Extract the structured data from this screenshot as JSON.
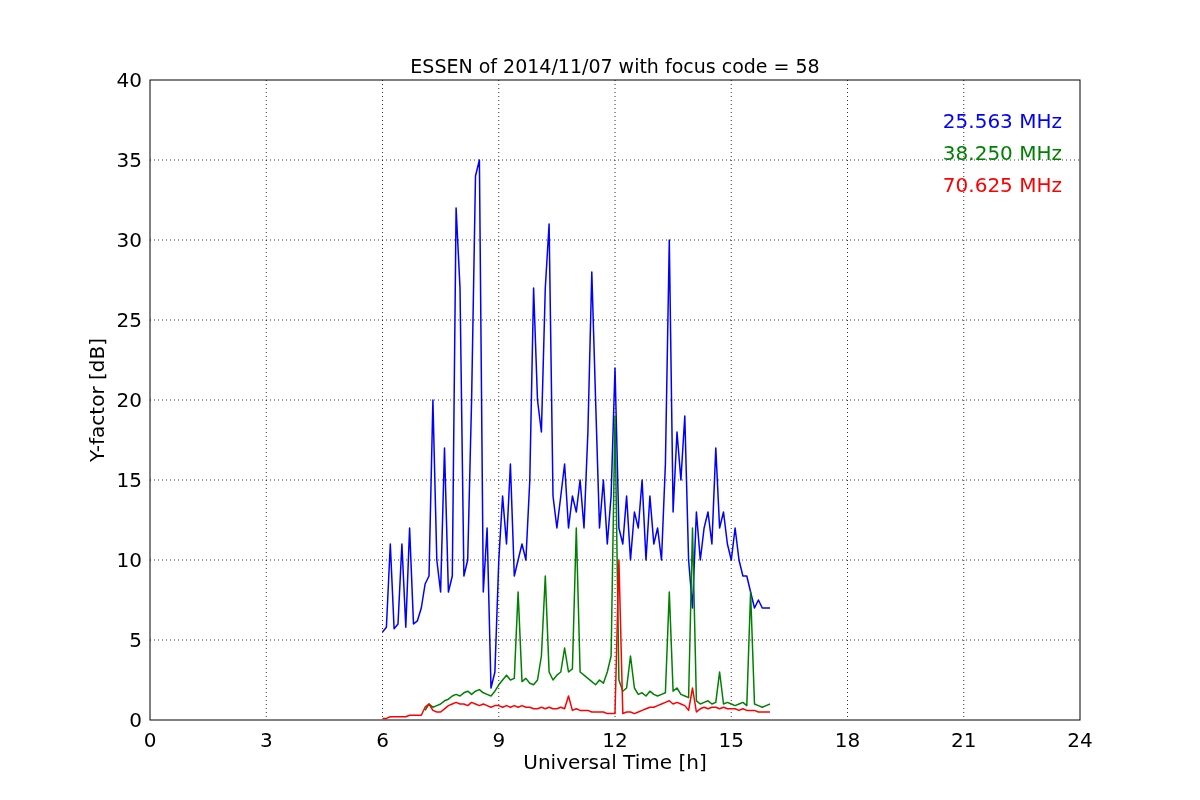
{
  "figure": {
    "chart_data": {
      "type": "line",
      "title": "ESSEN of 2014/11/07 with focus code = 58",
      "xlabel": "Universal Time [h]",
      "ylabel": "Y-factor [dB]",
      "grid": true,
      "xlim": [
        0,
        24
      ],
      "ylim": [
        0,
        40
      ],
      "xticks": [
        0,
        3,
        6,
        9,
        12,
        15,
        18,
        21,
        24
      ],
      "yticks": [
        0,
        5,
        10,
        15,
        20,
        25,
        30,
        35,
        40
      ],
      "x": [
        6.0,
        6.1,
        6.2,
        6.3,
        6.4,
        6.5,
        6.6,
        6.7,
        6.8,
        6.9,
        7.0,
        7.1,
        7.2,
        7.3,
        7.4,
        7.5,
        7.6,
        7.7,
        7.8,
        7.9,
        8.0,
        8.1,
        8.2,
        8.3,
        8.4,
        8.5,
        8.6,
        8.7,
        8.8,
        8.9,
        9.0,
        9.1,
        9.2,
        9.3,
        9.4,
        9.5,
        9.6,
        9.7,
        9.8,
        9.9,
        10.0,
        10.1,
        10.2,
        10.3,
        10.4,
        10.5,
        10.6,
        10.7,
        10.8,
        10.9,
        11.0,
        11.1,
        11.2,
        11.3,
        11.4,
        11.5,
        11.6,
        11.7,
        11.8,
        11.9,
        12.0,
        12.1,
        12.2,
        12.3,
        12.4,
        12.5,
        12.6,
        12.7,
        12.8,
        12.9,
        13.0,
        13.1,
        13.2,
        13.3,
        13.4,
        13.5,
        13.6,
        13.7,
        13.8,
        13.9,
        14.0,
        14.1,
        14.2,
        14.3,
        14.4,
        14.5,
        14.6,
        14.7,
        14.8,
        14.9,
        15.0,
        15.1,
        15.2,
        15.3,
        15.4,
        15.5,
        15.6,
        15.7,
        15.8,
        15.9,
        16.0
      ],
      "series": [
        {
          "name": "25.563 MHz",
          "color": "#0000ff",
          "values": [
            5.5,
            5.8,
            11,
            5.7,
            6,
            11,
            5.8,
            12,
            6,
            6.2,
            7,
            8.5,
            9,
            20,
            10,
            8,
            17,
            8,
            9,
            32,
            27,
            9,
            10,
            20,
            34,
            35,
            8,
            12,
            2,
            3,
            10,
            14,
            11,
            16,
            9,
            10,
            11,
            10,
            15,
            27,
            20,
            18,
            27,
            31,
            14,
            12,
            14,
            16,
            12,
            14,
            13,
            15,
            12,
            18,
            28,
            20,
            12,
            15,
            11,
            14,
            22,
            12,
            11,
            14,
            10,
            13,
            12,
            15,
            10,
            14,
            11,
            12,
            10,
            16,
            30,
            13,
            18,
            15,
            19,
            10,
            7,
            13,
            10,
            12,
            13,
            11,
            17,
            12,
            13,
            11,
            10,
            12,
            10,
            9,
            9,
            8,
            7,
            7.5,
            7,
            7,
            7
          ]
        },
        {
          "name": "38.250 MHz",
          "color": "#008000",
          "values": [
            null,
            null,
            null,
            null,
            null,
            null,
            null,
            null,
            null,
            null,
            null,
            0.6,
            1,
            0.8,
            0.9,
            1,
            1.2,
            1.3,
            1.5,
            1.6,
            1.5,
            1.7,
            1.8,
            1.6,
            1.8,
            1.9,
            1.7,
            1.6,
            1.5,
            1.8,
            2.2,
            2.5,
            2.8,
            2.5,
            2.6,
            8,
            2.4,
            2.6,
            2.3,
            2.2,
            2.5,
            4,
            9,
            3,
            2.5,
            2.8,
            3,
            4.5,
            3,
            3.2,
            12,
            3,
            2.8,
            2.6,
            2.4,
            2.2,
            2.5,
            2.3,
            3,
            4,
            19,
            2.5,
            1.8,
            2,
            4,
            2,
            1.6,
            1.7,
            1.5,
            1.8,
            1.6,
            1.5,
            1.6,
            1.7,
            8,
            1.8,
            2,
            1.6,
            1.5,
            1.4,
            12,
            1.2,
            1.0,
            1.1,
            1.2,
            1.0,
            1.1,
            3,
            1.0,
            1.1,
            1.0,
            0.9,
            1.0,
            1.1,
            0.9,
            8,
            1,
            0.9,
            0.8,
            0.9,
            1
          ]
        },
        {
          "name": "70.625 MHz",
          "color": "#ff0000",
          "values": [
            0.1,
            0.1,
            0.2,
            0.2,
            0.2,
            0.2,
            0.2,
            0.3,
            0.3,
            0.3,
            0.3,
            0.8,
            1,
            0.6,
            0.5,
            0.5,
            0.7,
            0.9,
            1,
            1.1,
            1,
            1,
            0.9,
            1.1,
            1,
            0.9,
            1,
            0.9,
            0.8,
            0.9,
            0.9,
            0.8,
            0.9,
            0.8,
            0.9,
            0.8,
            0.9,
            0.8,
            0.8,
            0.7,
            0.7,
            0.8,
            0.7,
            0.8,
            0.7,
            0.7,
            0.8,
            0.7,
            1.5,
            0.6,
            0.7,
            0.6,
            0.6,
            0.6,
            0.5,
            0.5,
            0.5,
            0.5,
            0.4,
            0.4,
            0.4,
            10,
            0.4,
            0.5,
            0.5,
            0.4,
            0.5,
            0.6,
            0.7,
            0.8,
            0.8,
            0.9,
            1,
            1.1,
            1.2,
            1,
            1.1,
            1,
            0.9,
            0.6,
            2,
            0.5,
            0.7,
            0.8,
            0.7,
            0.8,
            0.8,
            0.7,
            0.8,
            0.7,
            0.7,
            0.7,
            0.6,
            0.7,
            0.6,
            0.6,
            0.6,
            0.5,
            0.5,
            0.5,
            0.5
          ]
        }
      ]
    }
  }
}
